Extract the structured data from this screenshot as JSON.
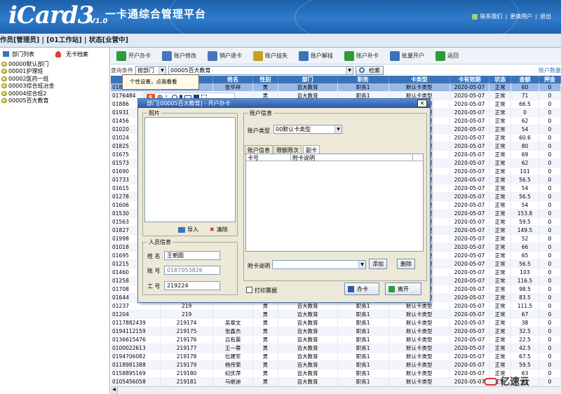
{
  "app": {
    "logo": "iCard3",
    "version": "V1.0",
    "title": "一卡通综合管理平台"
  },
  "toplinks": [
    "联系我们",
    "更换用户",
    "退出"
  ],
  "status": "作员[管理员] | [01工作站] | 状态[业营中]",
  "sidebar": {
    "head_left": "部门列表",
    "head_right": "无卡档案",
    "items": [
      "00000默认部门",
      "00001护理班",
      "00002医药一班",
      "00003综合班冶金",
      "00004综合班2",
      "00005百大教育"
    ]
  },
  "toolbar": [
    "开户办卡",
    "账户修改",
    "销户退卡",
    "账户挂失",
    "账户解挂",
    "账户补卡",
    "批量开户",
    "返回"
  ],
  "filter": {
    "label": "查询条件",
    "field": "按部门",
    "value": "00005百大教育",
    "search": "检索",
    "right": "账户数量"
  },
  "columns": [
    "账号",
    "卡号",
    "姓名",
    "性别",
    "部门",
    "职务",
    "卡类型",
    "卡有效期",
    "状态",
    "金额",
    "押金"
  ],
  "rows": [
    [
      "0187145",
      "219",
      "张华祥",
      "男",
      "百大教育",
      "职务1",
      "默认卡类型",
      "2020-05-07",
      "正常",
      "60",
      "0"
    ],
    [
      "0176484",
      "219",
      "",
      "男",
      "百大教育",
      "职务1",
      "默认卡类型",
      "2020-05-07",
      "正常",
      "71",
      "0"
    ],
    [
      "01886",
      "219",
      "",
      "男",
      "百大教育",
      "职务1",
      "默认卡类型",
      "2020-05-07",
      "正常",
      "66.5",
      "0"
    ],
    [
      "01931",
      "219",
      "",
      "男",
      "百大教育",
      "职务1",
      "默认卡类型",
      "2020-05-07",
      "正常",
      "0",
      "0"
    ],
    [
      "01456",
      "219",
      "",
      "男",
      "百大教育",
      "职务1",
      "默认卡类型",
      "2020-05-07",
      "正常",
      "62",
      "0"
    ],
    [
      "01020",
      "219",
      "",
      "男",
      "百大教育",
      "职务1",
      "默认卡类型",
      "2020-05-07",
      "正常",
      "54",
      "0"
    ],
    [
      "01024",
      "219",
      "",
      "男",
      "百大教育",
      "职务1",
      "默认卡类型",
      "2020-05-07",
      "正常",
      "60.6",
      "0"
    ],
    [
      "01825",
      "219",
      "",
      "男",
      "百大教育",
      "职务1",
      "默认卡类型",
      "2020-05-07",
      "正常",
      "80",
      "0"
    ],
    [
      "01675",
      "219",
      "",
      "男",
      "百大教育",
      "职务1",
      "默认卡类型",
      "2020-05-07",
      "正常",
      "69",
      "0"
    ],
    [
      "01573",
      "219",
      "",
      "男",
      "百大教育",
      "职务1",
      "默认卡类型",
      "2020-05-07",
      "正常",
      "62",
      "0"
    ],
    [
      "01690",
      "219",
      "",
      "男",
      "百大教育",
      "职务1",
      "默认卡类型",
      "2020-05-07",
      "正常",
      "101",
      "0"
    ],
    [
      "01733",
      "219",
      "",
      "男",
      "百大教育",
      "职务1",
      "默认卡类型",
      "2020-05-07",
      "正常",
      "56.5",
      "0"
    ],
    [
      "01615",
      "219",
      "",
      "男",
      "百大教育",
      "职务1",
      "默认卡类型",
      "2020-05-07",
      "正常",
      "54",
      "0"
    ],
    [
      "01278",
      "219",
      "",
      "男",
      "百大教育",
      "职务1",
      "默认卡类型",
      "2020-05-07",
      "正常",
      "56.5",
      "0"
    ],
    [
      "01606",
      "219",
      "",
      "男",
      "百大教育",
      "职务1",
      "默认卡类型",
      "2020-05-07",
      "正常",
      "54",
      "0"
    ],
    [
      "01530",
      "219",
      "",
      "男",
      "百大教育",
      "职务1",
      "默认卡类型",
      "2020-05-07",
      "正常",
      "153.8",
      "0"
    ],
    [
      "01563",
      "219",
      "",
      "男",
      "百大教育",
      "职务1",
      "默认卡类型",
      "2020-05-07",
      "正常",
      "59.5",
      "0"
    ],
    [
      "01827",
      "219",
      "",
      "男",
      "百大教育",
      "职务1",
      "默认卡类型",
      "2020-05-07",
      "正常",
      "149.5",
      "0"
    ],
    [
      "01998",
      "219",
      "",
      "男",
      "百大教育",
      "职务1",
      "默认卡类型",
      "2020-05-07",
      "正常",
      "52",
      "0"
    ],
    [
      "01018",
      "219",
      "",
      "男",
      "百大教育",
      "职务1",
      "默认卡类型",
      "2020-05-07",
      "正常",
      "66",
      "0"
    ],
    [
      "01695",
      "219",
      "",
      "男",
      "百大教育",
      "职务1",
      "默认卡类型",
      "2020-05-07",
      "正常",
      "65",
      "0"
    ],
    [
      "01215",
      "219",
      "",
      "男",
      "百大教育",
      "职务1",
      "默认卡类型",
      "2020-05-07",
      "正常",
      "56.5",
      "0"
    ],
    [
      "01460",
      "219",
      "",
      "男",
      "百大教育",
      "职务1",
      "默认卡类型",
      "2020-05-07",
      "正常",
      "103",
      "0"
    ],
    [
      "01258",
      "219",
      "",
      "男",
      "百大教育",
      "职务1",
      "默认卡类型",
      "2020-05-07",
      "正常",
      "116.5",
      "0"
    ],
    [
      "01708",
      "219",
      "",
      "男",
      "百大教育",
      "职务1",
      "默认卡类型",
      "2020-05-07",
      "正常",
      "98.5",
      "0"
    ],
    [
      "01644",
      "219",
      "",
      "男",
      "百大教育",
      "职务1",
      "默认卡类型",
      "2020-05-07",
      "正常",
      "83.5",
      "0"
    ],
    [
      "01237",
      "219",
      "",
      "男",
      "百大教育",
      "职务1",
      "默认卡类型",
      "2020-05-07",
      "正常",
      "111.5",
      "0"
    ],
    [
      "01204",
      "219",
      "",
      "男",
      "百大教育",
      "职务1",
      "默认卡类型",
      "2020-05-07",
      "正常",
      "67",
      "0"
    ],
    [
      "0117882439",
      "219174",
      "吴翠文",
      "男",
      "百大教育",
      "职务1",
      "默认卡类型",
      "2020-05-07",
      "正常",
      "38",
      "0"
    ],
    [
      "0194112159",
      "219175",
      "张鑫杰",
      "男",
      "百大教育",
      "职务1",
      "默认卡类型",
      "2020-05-07",
      "正常",
      "32.5",
      "0"
    ],
    [
      "0136615476",
      "219176",
      "吕有震",
      "男",
      "百大教育",
      "职务1",
      "默认卡类型",
      "2020-05-07",
      "正常",
      "22.5",
      "0"
    ],
    [
      "0100022613",
      "219177",
      "王一蒂",
      "男",
      "百大教育",
      "职务1",
      "默认卡类型",
      "2020-05-07",
      "正常",
      "42.5",
      "0"
    ],
    [
      "0194706082",
      "219178",
      "位建军",
      "男",
      "百大教育",
      "职务1",
      "默认卡类型",
      "2020-05-07",
      "正常",
      "67.5",
      "0"
    ],
    [
      "0118981388",
      "219179",
      "杨传荣",
      "男",
      "百大教育",
      "职务1",
      "默认卡类型",
      "2020-05-07",
      "正常",
      "59.5",
      "0"
    ],
    [
      "0158895169",
      "219180",
      "纪庆萍",
      "男",
      "百大教育",
      "职务1",
      "默认卡类型",
      "2020-05-07",
      "正常",
      "63",
      "0"
    ],
    [
      "0105456058",
      "219181",
      "马继迪",
      "男",
      "百大教育",
      "职务1",
      "默认卡类型",
      "2020-05-07",
      "正常",
      "63",
      "0"
    ],
    [
      "0123624407",
      "219182",
      "王颖",
      "男",
      "百大教育",
      "职务1",
      "默认卡类型",
      "2020-05-07",
      "正常",
      "83.5",
      "0"
    ],
    [
      "0123766488",
      "219183",
      "田奥生",
      "男",
      "百大教育",
      "职务1",
      "默认卡类型",
      "2020-05-07",
      "正常",
      "63",
      "0"
    ]
  ],
  "popup": "个性设置，点我看看",
  "ime": {
    "s": "S",
    "lang": "中"
  },
  "dialog": {
    "title": "部门[00005百大教育] - 开户办卡",
    "photo_group": "照片",
    "import": "导入",
    "delete": "清除",
    "person_group": "人员信息",
    "name_label": "姓 名",
    "name": "王朝圆",
    "acct_label": "账 号",
    "acct": "0187053826",
    "job_label": "工 号",
    "job": "219224",
    "account_group": "账户信息",
    "card_type_label": "账户类型",
    "card_type": "00默认卡类型",
    "tabs": [
      "账户信息",
      "限额限次",
      "副卡"
    ],
    "sub_cols": [
      "卡号",
      "附卡说明"
    ],
    "sub_label": "附卡说明",
    "add": "添加",
    "remove": "删除",
    "print": "打印票据",
    "issue": "办卡",
    "exit": "离开"
  },
  "watermark": "亿速云"
}
